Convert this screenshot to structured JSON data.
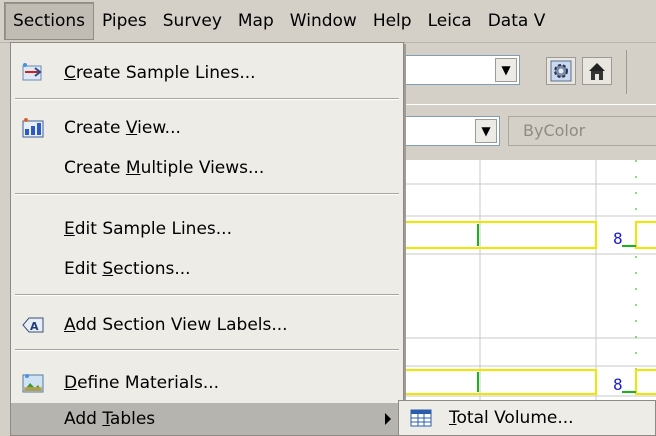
{
  "menubar": {
    "items": [
      {
        "label": "Sections",
        "active": true
      },
      {
        "label": "Pipes"
      },
      {
        "label": "Survey"
      },
      {
        "label": "Map"
      },
      {
        "label": "Window"
      },
      {
        "label": "Help"
      },
      {
        "label": "Leica"
      },
      {
        "label": "Data V"
      }
    ]
  },
  "toolbar": {
    "color_combo_value": "ByColor",
    "icons": [
      "gear-icon",
      "house-icon"
    ]
  },
  "sections_menu": {
    "items": [
      {
        "pre": "",
        "ul": "C",
        "post": "reate Sample Lines...",
        "icon": "sample-lines-icon"
      },
      {
        "pre": "Create ",
        "ul": "V",
        "post": "iew...",
        "icon": "create-view-icon"
      },
      {
        "pre": "Create ",
        "ul": "M",
        "post": "ultiple Views...",
        "icon": ""
      },
      {
        "pre": "",
        "ul": "E",
        "post": "dit Sample Lines...",
        "icon": ""
      },
      {
        "pre": "Edit ",
        "ul": "S",
        "post": "ections...",
        "icon": ""
      },
      {
        "pre": "",
        "ul": "A",
        "post": "dd Section View Labels...",
        "icon": "add-labels-icon"
      },
      {
        "pre": "",
        "ul": "D",
        "post": "efine Materials...",
        "icon": "define-materials-icon"
      },
      {
        "pre": "Add ",
        "ul": "T",
        "post": "ables",
        "icon": "",
        "submenu": true,
        "highlighted": true
      }
    ]
  },
  "tables_submenu": {
    "items": [
      {
        "pre": "",
        "ul": "T",
        "post": "otal Volume...",
        "icon": "table-icon"
      }
    ]
  },
  "colors": {
    "menu_bg": "#eeece6",
    "highlight": "#b6b4ae",
    "drawing_line": "#f2e600",
    "drawing_green": "#18b418",
    "drawing_blue": "#1c1cd0"
  }
}
